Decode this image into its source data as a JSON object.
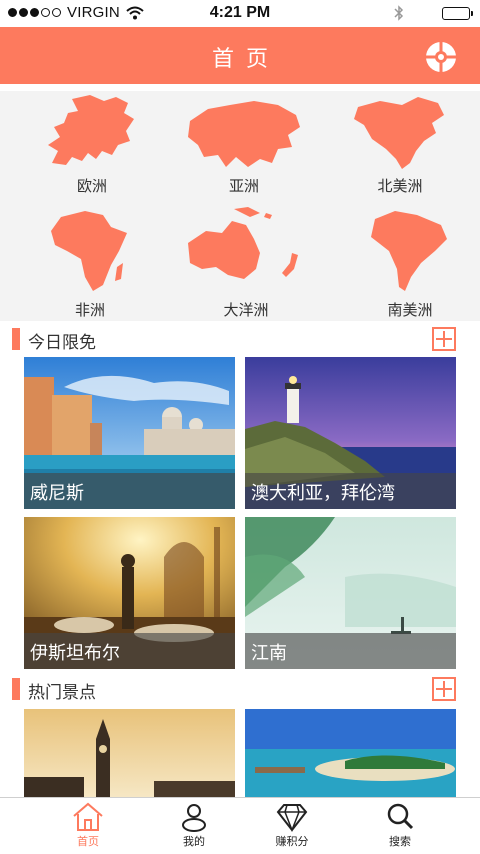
{
  "status_bar": {
    "carrier": "VIRGIN",
    "time": "4:21 PM"
  },
  "header": {
    "title": "首页",
    "menu_icon": "compass-icon"
  },
  "continents": [
    {
      "label": "欧洲",
      "icon": "europe-map-icon"
    },
    {
      "label": "亚洲",
      "icon": "asia-map-icon"
    },
    {
      "label": "北美洲",
      "icon": "north-america-map-icon"
    },
    {
      "label": "非洲",
      "icon": "africa-map-icon"
    },
    {
      "label": "大洋洲",
      "icon": "oceania-map-icon"
    },
    {
      "label": "南美洲",
      "icon": "south-america-map-icon"
    }
  ],
  "sections": {
    "free_today": {
      "title": "今日限免",
      "cards": [
        {
          "caption": "威尼斯"
        },
        {
          "caption": "澳大利亚，拜伦湾"
        },
        {
          "caption": "伊斯坦布尔"
        },
        {
          "caption": "江南"
        }
      ]
    },
    "hot_spots": {
      "title": "热门景点"
    }
  },
  "tabbar": [
    {
      "label": "首页",
      "icon": "home-icon",
      "active": true
    },
    {
      "label": "我的",
      "icon": "user-icon",
      "active": false
    },
    {
      "label": "赚积分",
      "icon": "diamond-icon",
      "active": false
    },
    {
      "label": "搜索",
      "icon": "search-icon",
      "active": false
    }
  ],
  "colors": {
    "accent": "#fd7a5e",
    "panel": "#f3f3f3",
    "caption_bg": "#464646"
  }
}
